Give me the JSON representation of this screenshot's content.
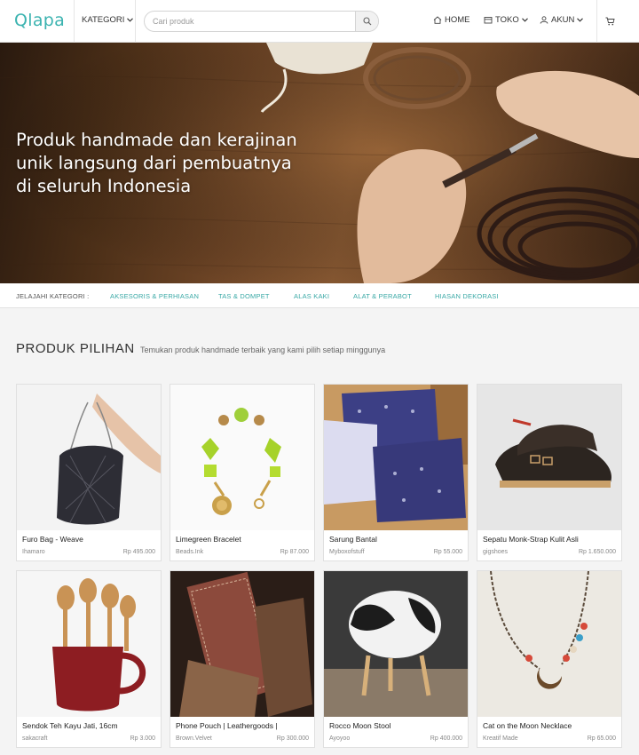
{
  "header": {
    "logo": "Qlapa",
    "kategori_label": "KATEGORI",
    "search_placeholder": "Cari produk",
    "nav": {
      "home": "HOME",
      "toko": "TOKO",
      "akun": "AKUN"
    }
  },
  "hero": {
    "title_lines": [
      "Produk handmade dan kerajinan",
      "unik langsung dari pembuatnya",
      "di seluruh Indonesia"
    ]
  },
  "category_bar": {
    "label": "JELAJAHI KATEGORI :",
    "links": [
      "AKSESORIS & PERHIASAN",
      "TAS & DOMPET",
      "ALAS KAKI",
      "ALAT & PERABOT",
      "HIASAN DEKORASI"
    ]
  },
  "featured": {
    "title": "PRODUK PILIHAN",
    "subtitle": "Temukan produk handmade terbaik yang kami pilih setiap minggunya",
    "products": [
      {
        "name": "Furo Bag - Weave",
        "seller": "Ihamaro",
        "price": "Rp 495.000"
      },
      {
        "name": "Limegreen Bracelet",
        "seller": "Beads.Ink",
        "price": "Rp 87.000"
      },
      {
        "name": "Sarung Bantal",
        "seller": "Myboxofstuff",
        "price": "Rp 55.000"
      },
      {
        "name": "Sepatu Monk-Strap Kulit Asli",
        "seller": "gigshoes",
        "price": "Rp 1.650.000"
      },
      {
        "name": "Sendok Teh Kayu Jati, 16cm",
        "seller": "sakacraft",
        "price": "Rp 3.000"
      },
      {
        "name": "Phone Pouch | Leathergoods |",
        "seller": "Brown.Velvet",
        "price": "Rp 300.000"
      },
      {
        "name": "Rocco Moon Stool",
        "seller": "Ayoyoo",
        "price": "Rp 400.000"
      },
      {
        "name": "Cat on the Moon Necklace",
        "seller": "Kreatif Made",
        "price": "Rp 65.000"
      }
    ]
  },
  "colors": {
    "accent": "#3bb3b0",
    "link": "#3aa9a6",
    "background": "#f4f4f4"
  }
}
